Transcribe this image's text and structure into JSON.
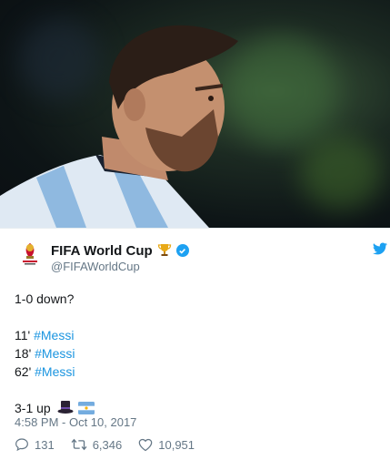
{
  "account": {
    "display_name": "FIFA World Cup",
    "handle": "@FIFAWorldCup",
    "verified": true
  },
  "tweet": {
    "line1": "1-0 down?",
    "goals": [
      {
        "minute": "11'",
        "hashtag": "#Messi"
      },
      {
        "minute": "18'",
        "hashtag": "#Messi"
      },
      {
        "minute": "62'",
        "hashtag": "#Messi"
      }
    ],
    "final_line": "3-1 up",
    "timestamp": "4:58 PM - Oct 10, 2017"
  },
  "actions": {
    "replies": "131",
    "retweets": "6,346",
    "likes": "10,951"
  },
  "icons": {
    "avatar": "fifa-world-cup-logo-icon",
    "trophy": "trophy-icon",
    "verified": "verified-badge-icon",
    "brand": "twitter-bird-icon",
    "reply": "reply-icon",
    "retweet": "retweet-icon",
    "like": "heart-icon",
    "hat": "top-hat-icon",
    "flag": "argentina-flag-icon"
  },
  "colors": {
    "link": "#1b95e0",
    "verified": "#1da1f2",
    "secondary_text": "#657786"
  }
}
